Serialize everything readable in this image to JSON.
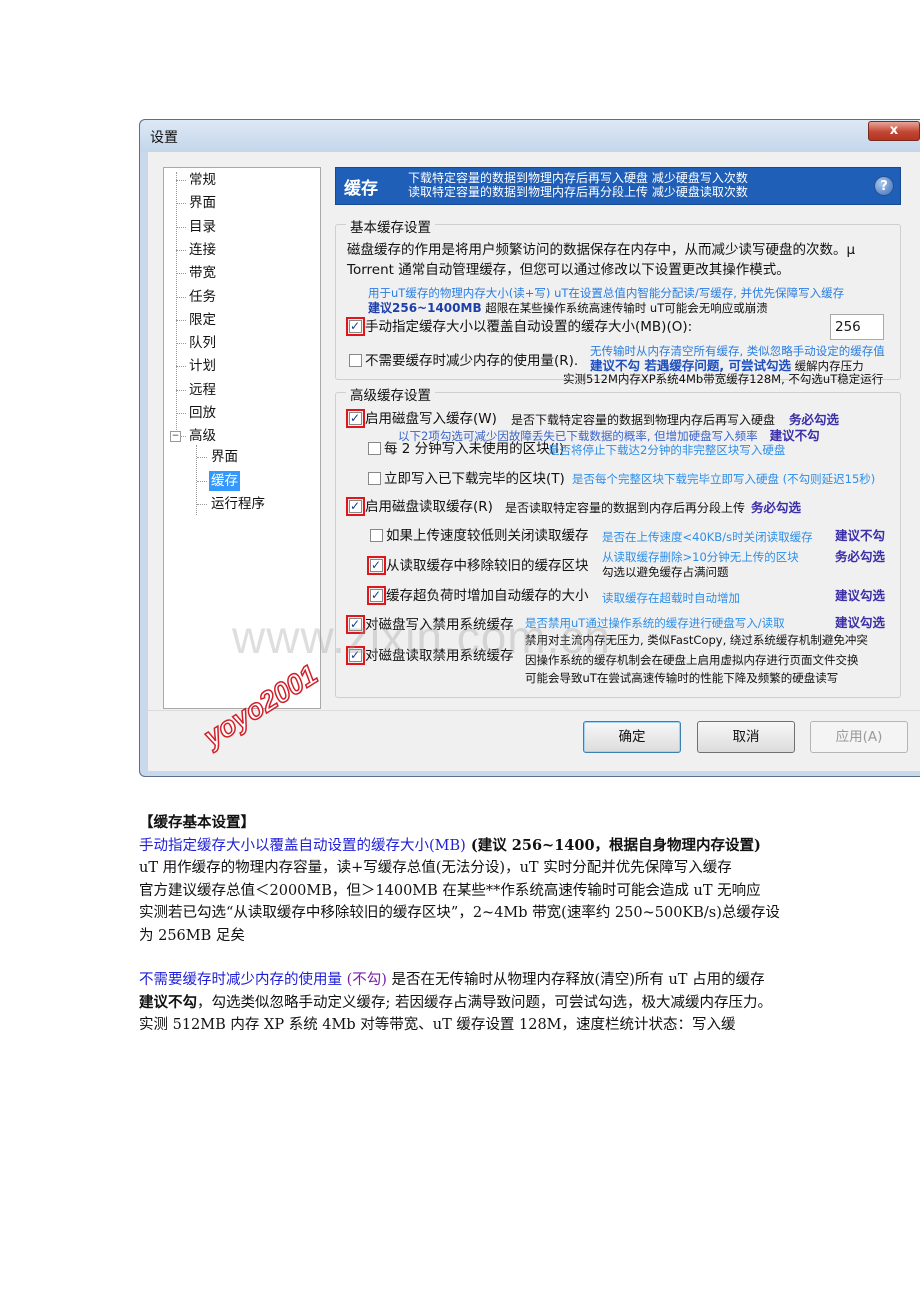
{
  "dialog": {
    "title": "设置",
    "close_label": "x",
    "tree": [
      "常规",
      "界面",
      "目录",
      "连接",
      "带宽",
      "任务",
      "限定",
      "队列",
      "计划",
      "远程",
      "回放",
      "高级"
    ],
    "tree_children": [
      "界面",
      "缓存",
      "运行程序"
    ],
    "expander": "−",
    "banner": {
      "title": "缓存",
      "line1": "下载特定容量的数据到物理内存后再写入硬盘   减少硬盘写入次数",
      "line2": "读取特定容量的数据到物理内存后再分段上传   减少硬盘读取次数",
      "help": "?"
    },
    "basic": {
      "title": "基本缓存设置",
      "desc1": "磁盘缓存的作用是将用户频繁访问的数据保存在内存中，从而减少读写硬盘的次数。µ",
      "desc2": "Torrent 通常自动管理缓存，但您可以通过修改以下设置更改其操作模式。",
      "ann1": "用于uT缓存的物理内存大小(读+写) uT在设置总值内智能分配读/写缓存, 并优先保障写入缓存",
      "ann2_bold": "建议256~1400MB",
      "ann2_rest": " 超限在某些操作系统高速传输时 uT可能会无响应或崩溃",
      "cb1": "手动指定缓存大小以覆盖自动设置的缓存大小(MB)(O):",
      "cb1_value": "256",
      "cb2": "不需要缓存时减少内存的使用量(R).",
      "ann3": "无传输时从内存清空所有缓存, 类似忽略手动设定的缓存值",
      "ann4_bold": "建议不勾  若遇缓存问题, 可尝试勾选",
      "ann4_rest": " 缓解内存压力",
      "ann5": "实测512M内存XP系统4Mb带宽缓存128M, 不勾选uT稳定运行"
    },
    "advanced": {
      "title": "高级缓存设置",
      "cb3": "启用磁盘写入缓存(W)",
      "cb3_ann": "是否下载特定容量的数据到物理内存后再写入硬盘",
      "cb3_tag": "务必勾选",
      "ann6": "以下2项勾选可减少因故障丢失已下载数据的概率, 但增加硬盘写入频率",
      "ann6_tag": "建议不勾",
      "cb4": "每 2 分钟写入未使用的区块(I)",
      "cb4_ann": "是否将停止下载达2分钟的非完整区块写入硬盘",
      "cb5": "立即写入已下载完毕的区块(T)",
      "cb5_ann": "是否每个完整区块下载完毕立即写入硬盘 (不勾则延迟15秒)",
      "cb6": "启用磁盘读取缓存(R)",
      "cb6_ann": "是否读取特定容量的数据到内存后再分段上传",
      "cb6_tag": "务必勾选",
      "cb7": "如果上传速度较低则关闭读取缓存",
      "cb7_ann": "是否在上传速度<40KB/s时关闭读取缓存",
      "cb7_tag": "建议不勾",
      "cb8": "从读取缓存中移除较旧的缓存区块",
      "cb8_ann1": "从读取缓存删除>10分钟无上传的区块",
      "cb8_ann2": "勾选以避免缓存占满问题",
      "cb8_tag": "务必勾选",
      "cb9": "缓存超负荷时增加自动缓存的大小",
      "cb9_ann": "读取缓存在超载时自动增加",
      "cb9_tag": "建议勾选",
      "cb10": "对磁盘写入禁用系统缓存",
      "cb10_ann": "是否禁用uT通过操作系统的缓存进行硬盘写入/读取",
      "cb10_tag": "建议勾选",
      "cb11": "对磁盘读取禁用系统缓存",
      "ann7": "禁用对主流内存无压力, 类似FastCopy, 绕过系统缓存机制避免冲突",
      "ann8": "因操作系统的缓存机制会在硬盘上启用虚拟内存进行页面文件交换",
      "ann9": "可能会导致uT在尝试高速传输时的性能下降及频繁的硬盘读写"
    },
    "buttons": {
      "ok": "确定",
      "cancel": "取消",
      "apply": "应用(A)"
    },
    "watermark": "www.zixin.com.cn",
    "stamp": "yoyo2001"
  },
  "article": {
    "heading": "【缓存基本设置】",
    "p1_link": "手动指定缓存大小以覆盖自动设置的缓存大小(MB)",
    "p1_rest": " (建议 256~1400，根据自身物理内存设置)",
    "p2": "uT 用作缓存的物理内存容量，读+写缓存总值(无法分设)，uT 实时分配并优先保障写入缓存",
    "p3": "官方建议缓存总值＜2000MB，但＞1400MB 在某些**作系统高速传输时可能会造成 uT 无响应",
    "p4": "实测若已勾选“从读取缓存中移除较旧的缓存区块”，2~4Mb 带宽(速率约 250~500KB/s)总缓存设为 256MB 足矣",
    "p5_link": "不需要缓存时减少内存的使用量",
    "p5_tag": " (不勾)",
    "p5_rest": " 是否在无传输时从物理内存释放(清空)所有 uT 占用的缓存",
    "p6_bold": "建议不勾",
    "p6_rest": "，勾选类似忽略手动定义缓存; 若因缓存占满导致问题，可尝试勾选，极大减缓内存压力。",
    "p7": "实测 512MB 内存 XP 系统 4Mb 对等带宽、uT 缓存设置 128M，速度栏统计状态：写入缓"
  }
}
